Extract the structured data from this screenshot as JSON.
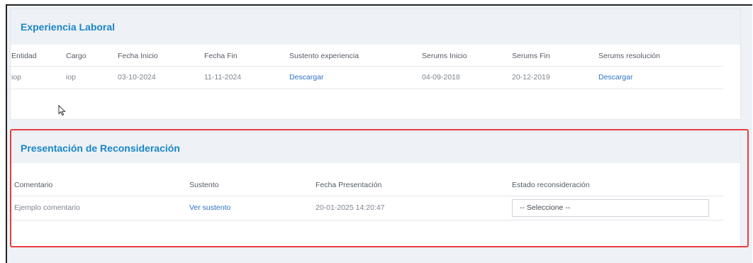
{
  "experiencia": {
    "title": "Experiencia Laboral",
    "headers": {
      "entidad": "Entidad",
      "cargo": "Cargo",
      "fecha_inicio": "Fecha Inicio",
      "fecha_fin": "Fecha Fin",
      "sustento": "Sustento experiencia",
      "serums_inicio": "Serums Inicio",
      "serums_fin": "Serums Fin",
      "serums_resolucion": "Serums resolución"
    },
    "row": {
      "entidad": "iop",
      "cargo": "iop",
      "fecha_inicio": "03-10-2024",
      "fecha_fin": "11-11-2024",
      "sustento": "Descargar",
      "serums_inicio": "04-09-2018",
      "serums_fin": "20-12-2019",
      "serums_resolucion": "Descargar"
    }
  },
  "reconsideracion": {
    "title": "Presentación de Reconsideración",
    "headers": {
      "comentario": "Comentario",
      "sustento": "Sustento",
      "fecha": "Fecha Presentación",
      "estado": "Estado reconsideración"
    },
    "row": {
      "comentario": "Ejemplo comentario",
      "sustento": "Ver sustento",
      "fecha": "20-01-2025 14:20:47",
      "estado": "-- Seleccione --"
    }
  },
  "colors": {
    "accent": "#1a86c8",
    "link": "#2f72c7",
    "highlight": "#e53e3e"
  },
  "icons": {
    "cursor": "mouse-pointer-icon"
  }
}
